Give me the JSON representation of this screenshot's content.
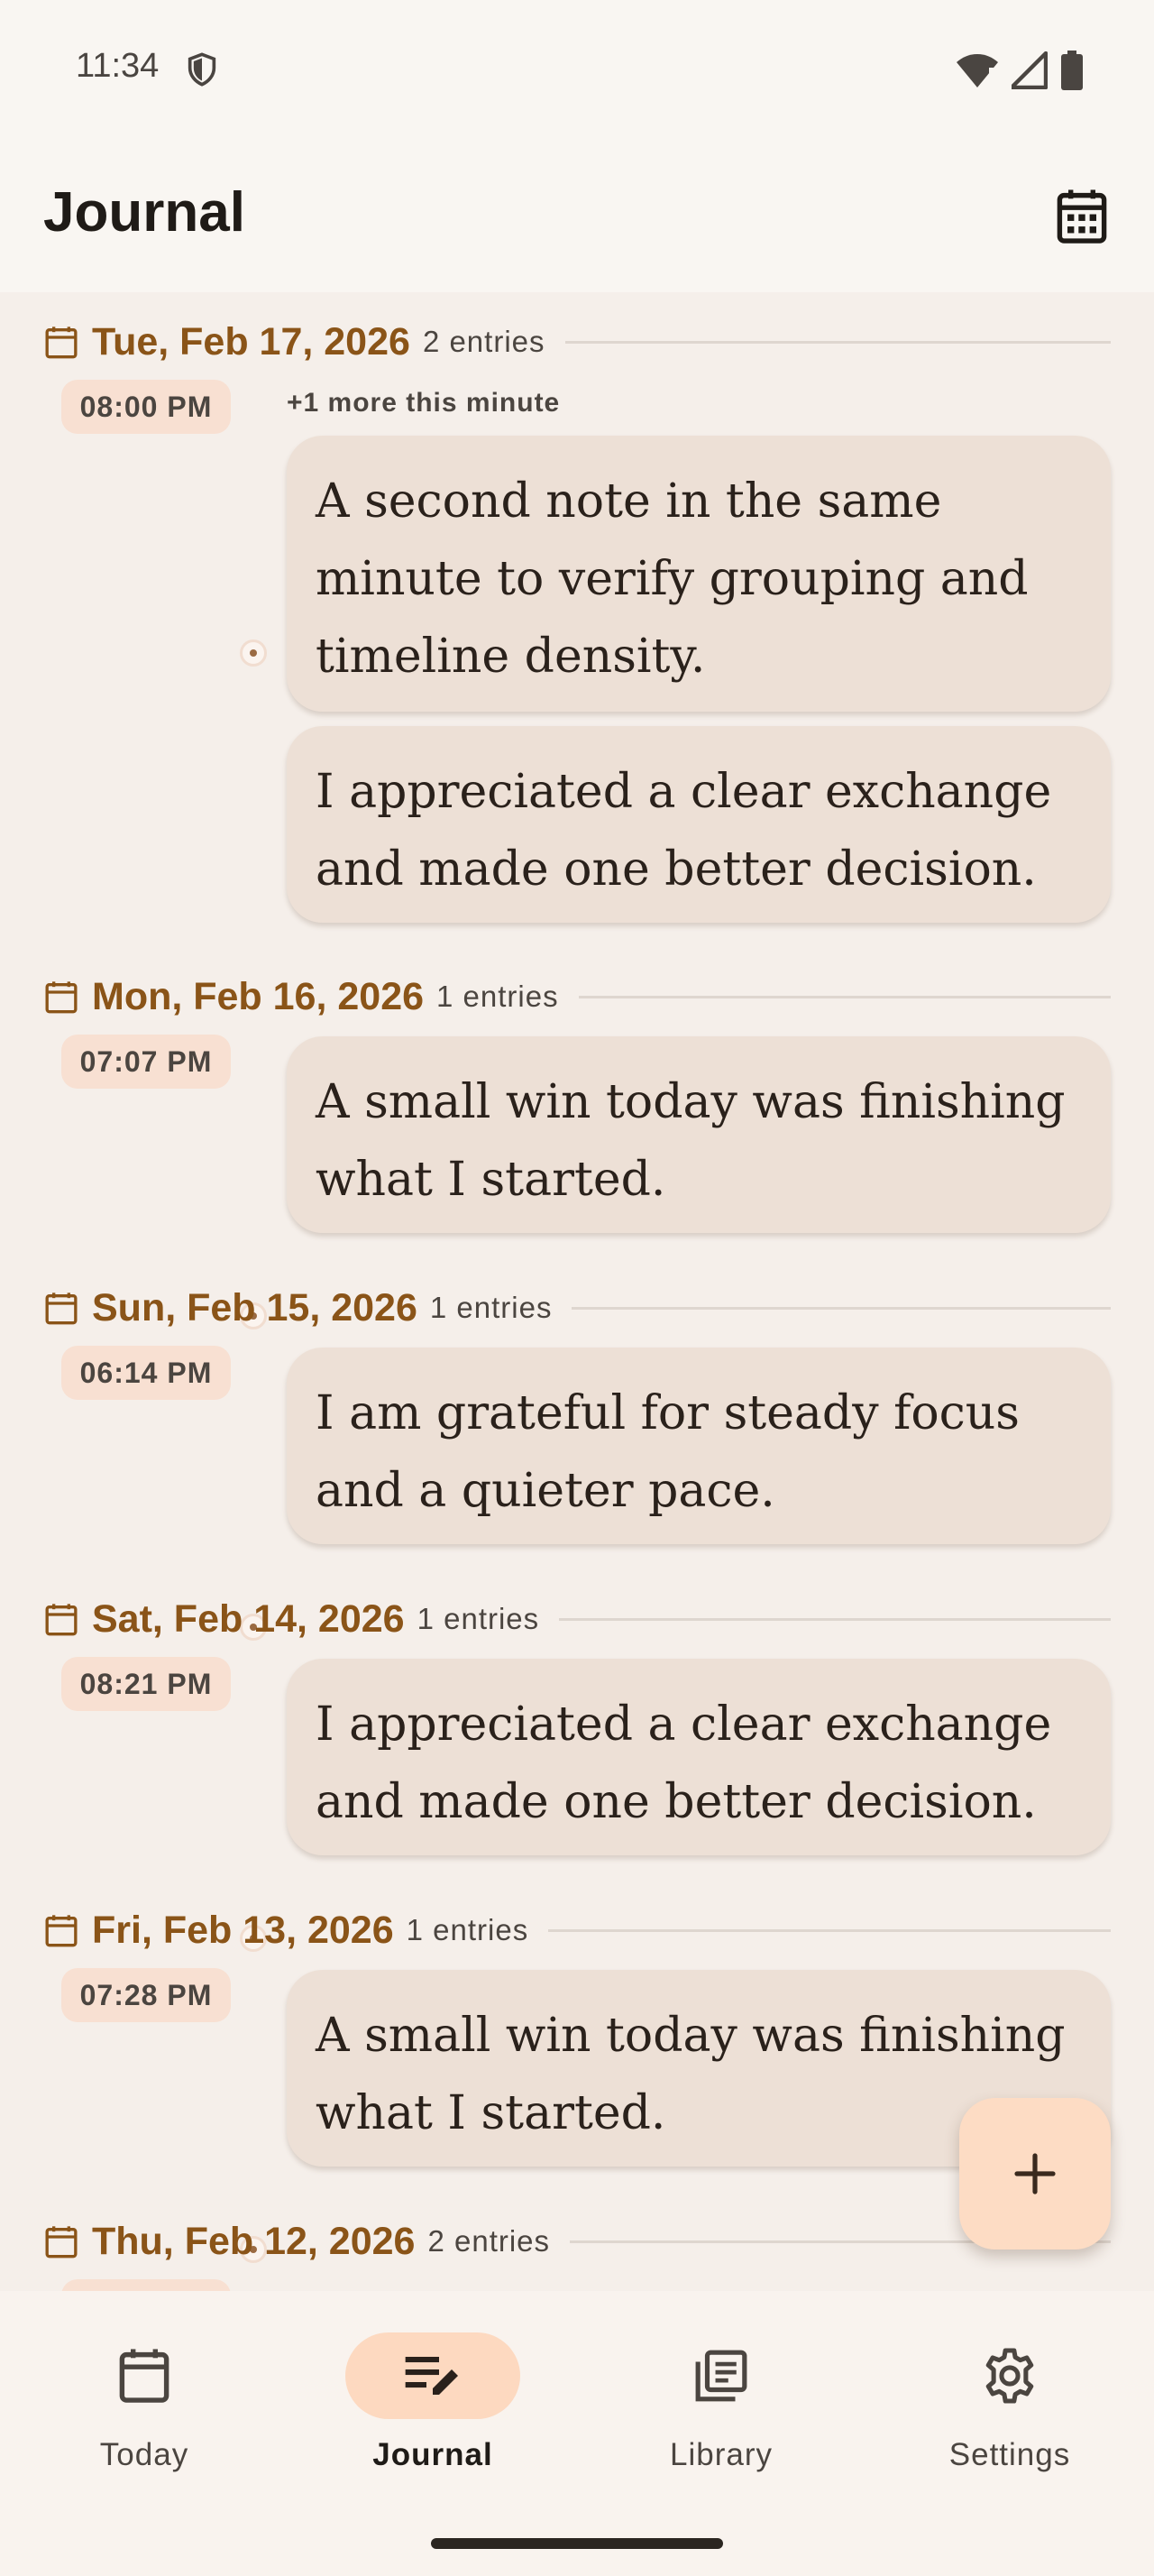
{
  "status_bar": {
    "time": "11:34"
  },
  "app_bar": {
    "title": "Journal"
  },
  "days": [
    {
      "date": "Tue, Feb 17, 2026",
      "count": "2 entries",
      "time": "08:00 PM",
      "more": "+1 more this minute",
      "entries": [
        "A second note in the same minute to verify grouping and timeline density.",
        "I appreciated a clear exchange and made one better decision."
      ]
    },
    {
      "date": "Mon, Feb 16, 2026",
      "count": "1 entries",
      "time": "07:07 PM",
      "entries": [
        "A small win today was finishing what I started."
      ]
    },
    {
      "date": "Sun, Feb 15, 2026",
      "count": "1 entries",
      "time": "06:14 PM",
      "entries": [
        "I am grateful for steady focus and a quieter pace."
      ]
    },
    {
      "date": "Sat, Feb 14, 2026",
      "count": "1 entries",
      "time": "08:21 PM",
      "entries": [
        "I appreciated a clear exchange and made one better decision."
      ]
    },
    {
      "date": "Fri, Feb 13, 2026",
      "count": "1 entries",
      "time": "07:28 PM",
      "entries": [
        "A small win today was finishing what I started."
      ]
    },
    {
      "date": "Thu, Feb 12, 2026",
      "count": "2 entries"
    }
  ],
  "fab": {
    "icon": "plus-icon"
  },
  "bottom_nav": [
    {
      "label": "Today",
      "icon": "calendar-icon"
    },
    {
      "label": "Journal",
      "icon": "edit-note-icon",
      "active": true
    },
    {
      "label": "Library",
      "icon": "library-icon"
    },
    {
      "label": "Settings",
      "icon": "gear-icon"
    }
  ],
  "colors": {
    "accent": "#8a5418",
    "card": "#ede0d6",
    "chip": "#f8e0d2",
    "fab": "#fddcc4",
    "nav_active": "#fdd9c0"
  }
}
